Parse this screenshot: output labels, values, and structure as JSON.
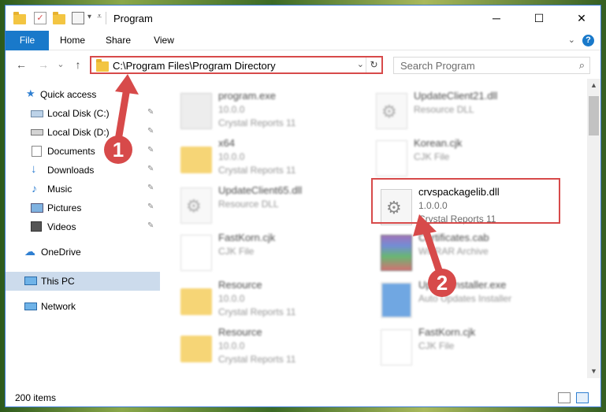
{
  "window": {
    "title": "Program",
    "minimize": "─",
    "maximize": "☐",
    "close": "✕"
  },
  "ribbon": {
    "tabs": [
      "File",
      "Home",
      "Share",
      "View"
    ],
    "help": "?"
  },
  "nav": {
    "back": "←",
    "forward": "→",
    "recent": "⌄",
    "up": "↑",
    "address": "C:\\Program Files\\Program Directory",
    "refresh": "↻",
    "search_placeholder": "Search Program",
    "search_icon": "⌕"
  },
  "sidebar": {
    "items": [
      {
        "label": "Quick access",
        "icon": "star-icon"
      },
      {
        "label": "Local Disk (C:)",
        "icon": "drive-icon",
        "pinned": true
      },
      {
        "label": "Local Disk (D:)",
        "icon": "drive-icon",
        "pinned": true
      },
      {
        "label": "Documents",
        "icon": "documents-icon",
        "pinned": true
      },
      {
        "label": "Downloads",
        "icon": "downloads-icon",
        "pinned": true
      },
      {
        "label": "Music",
        "icon": "music-icon",
        "pinned": true
      },
      {
        "label": "Pictures",
        "icon": "pictures-icon",
        "pinned": true
      },
      {
        "label": "Videos",
        "icon": "videos-icon",
        "pinned": true
      },
      {
        "label": "OneDrive",
        "icon": "cloud-icon"
      },
      {
        "label": "This PC",
        "icon": "pc-icon",
        "selected": true
      },
      {
        "label": "Network",
        "icon": "network-icon"
      }
    ],
    "pin_glyph": "📌"
  },
  "files": [
    {
      "name": "program.exe",
      "version": "10.0.0",
      "type": "Crystal Reports 11",
      "icon": "exe-icon"
    },
    {
      "name": "UpdateClient21.dll",
      "version": "",
      "type": "Resource DLL",
      "icon": "dll-icon"
    },
    {
      "name": "x64",
      "version": "10.0.0",
      "type": "Crystal Reports 11",
      "icon": "folder-icon"
    },
    {
      "name": "Korean.cjk",
      "version": "",
      "type": "CJK File",
      "icon": "document-icon"
    },
    {
      "name": "UpdateClient65.dll",
      "version": "",
      "type": "Resource DLL",
      "icon": "dll-icon"
    },
    {
      "name": "crvspackagelib.dll",
      "version": "1.0.0.0",
      "type": "Crystal Reports 11",
      "icon": "dll-icon",
      "highlighted": true
    },
    {
      "name": "FastKorn.cjk",
      "version": "",
      "type": "CJK File",
      "icon": "document-icon"
    },
    {
      "name": "Certificates.cab",
      "version": "",
      "type": "WinRAR Archive",
      "icon": "archive-icon"
    },
    {
      "name": "Resource",
      "version": "10.0.0",
      "type": "Crystal Reports 11",
      "icon": "folder-icon"
    },
    {
      "name": "UpdateInstaller.exe",
      "version": "",
      "type": "Auto Updates Installer",
      "icon": "installer-icon"
    },
    {
      "name": "Resource",
      "version": "10.0.0",
      "type": "Crystal Reports 11",
      "icon": "folder-icon"
    },
    {
      "name": "FastKorn.cjk",
      "version": "",
      "type": "CJK File",
      "icon": "document-icon"
    }
  ],
  "status": {
    "items_count": "200 items"
  },
  "annotations": {
    "step1": "1",
    "step2": "2",
    "color": "#d74a4a"
  }
}
